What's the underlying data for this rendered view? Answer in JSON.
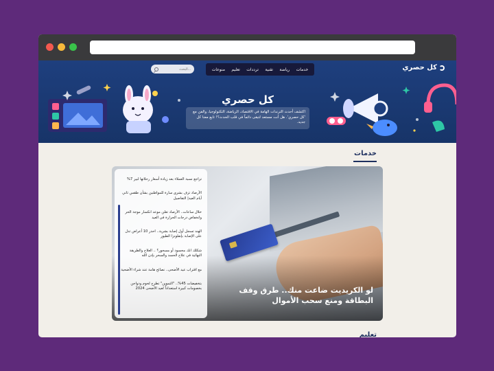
{
  "browser": {
    "url": ""
  },
  "site": {
    "logo_text": "كل حصري",
    "nav_items": [
      "خدمات",
      "رياضة",
      "تقنية",
      "ترددات",
      "تعليم",
      "منوعات"
    ],
    "search_placeholder": "البحث..."
  },
  "hero": {
    "title": "كل حصري",
    "description": "اكتشف أحدث الترندات الهامة في الاقتصاد، الرياضة، التكنولوجيا، والفن مع 'كل حصري'. هل أنت مستعد لتبقى دائماً في قلب الحدث؟! تابع معنا كل جديد."
  },
  "sections": {
    "services_title": "خدمات",
    "next_title": "تعليم"
  },
  "featured": {
    "headline": "لو الكريديت ضاعت منك.. طرق وقف البطاقة ومنع سحب الأموال"
  },
  "news": [
    "تراجع نسبة العملاء بعد زيادة أسعار رحلاتها لبير 7%",
    "الأرصاد تزف بشرى سارة للمواطنين بشأن طقس ثاني أيام العيد| التفاصيل",
    "خلال ساعات.. الأرصاد تعلن موعد انكسار موجة الحر وانخفاض درجات الحرارة في العيد",
    "الهند تسجل أول إصابة بشرية.. احذر 10 أعراض تدل على الإصابة بإنفلونزا الطيور",
    "شكلك انك محسود أو مسحور؟ .. العلاج والطريقة النهائية في علاج الحسد والسحر بإذن الله",
    "مع اقتراب عيد الأضحى.. نصائح هامة عند شراء الأضحية",
    "بتخفيضات 45%.. \"التموين\" تطرح لحوم ودواجن بخصومات كبيرة استعداداً لعيد الأضحى 2024"
  ],
  "colors": {
    "background": "#5e2a7a",
    "hero": "#1e3f7e",
    "accent": "#1d2f5e"
  }
}
